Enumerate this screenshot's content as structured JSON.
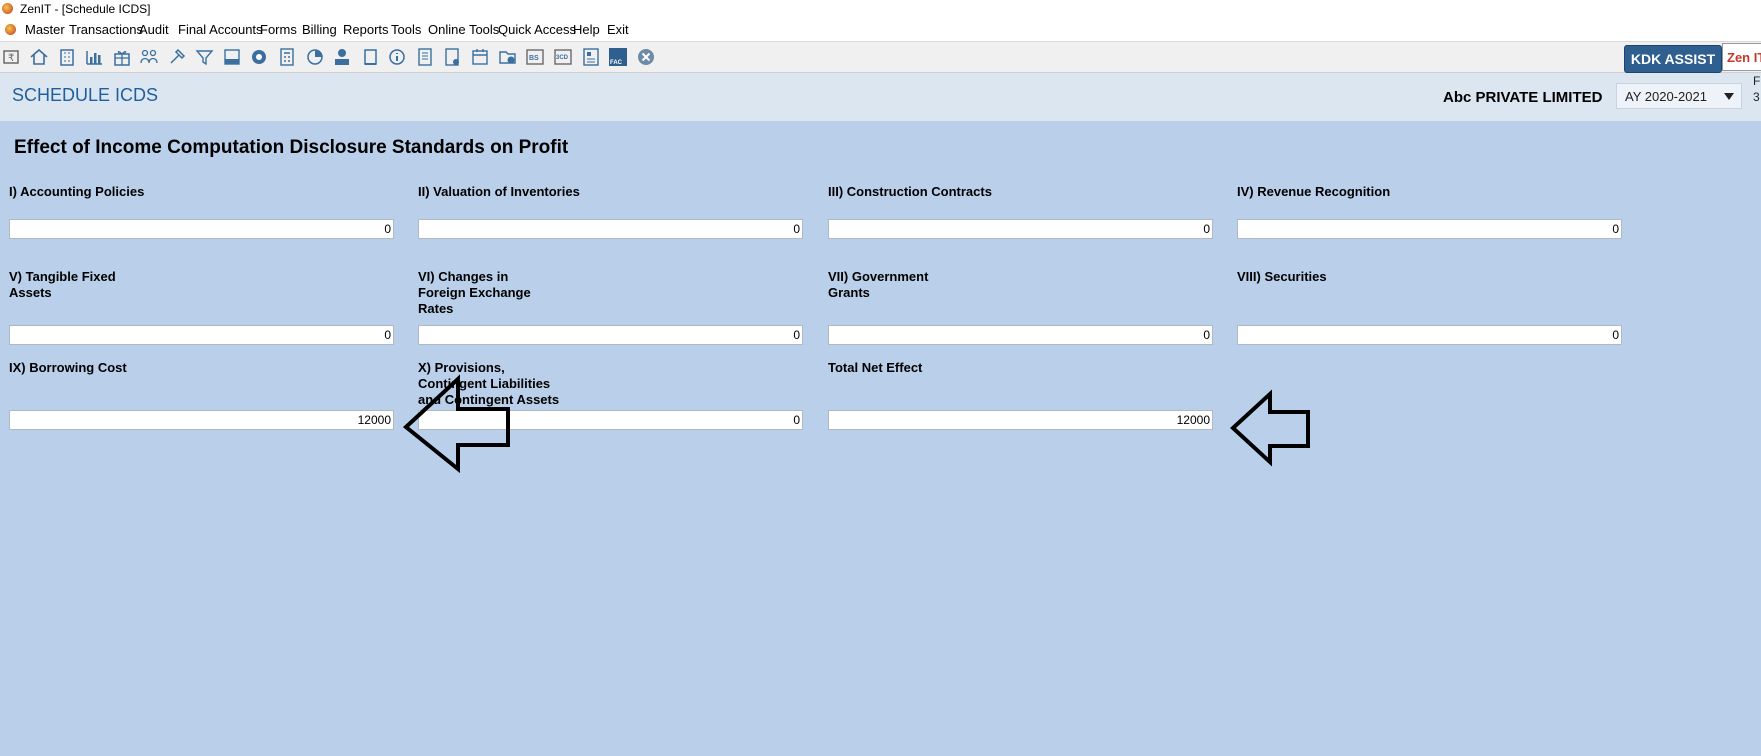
{
  "window": {
    "title": "ZenIT - [Schedule ICDS]"
  },
  "menu": {
    "items": [
      "Master",
      "Transactions",
      "Audit",
      "Final Accounts",
      "Forms",
      "Billing",
      "Reports",
      "Tools",
      "Online Tools",
      "Quick Access",
      "Help",
      "Exit"
    ]
  },
  "toolbar": {
    "icons": [
      "rupee-icon",
      "home-icon",
      "building-icon",
      "bar-chart-icon",
      "gift-icon",
      "users-icon",
      "hammer-icon",
      "filter-icon",
      "tax-icon",
      "eye-icon",
      "calculator-icon",
      "pie-icon",
      "pay-icon",
      "book-icon",
      "info-icon",
      "report-icon",
      "document-icon",
      "calendar-icon",
      "folder-add-icon",
      "bs-icon",
      "3cd-icon",
      "form-icon",
      "fac-icon",
      "close-circle-icon"
    ],
    "kdk_assist": "KDK ASSIST",
    "zen_it": "Zen IT"
  },
  "header": {
    "screen_title": "SCHEDULE ICDS",
    "company": "Abc PRIVATE LIMITED",
    "assessment_year": "AY 2020-2021",
    "edge_text_1": "F",
    "edge_text_2": "3"
  },
  "form": {
    "section_title": "Effect of Income Computation Disclosure Standards on Profit",
    "fields": [
      {
        "label": "I) Accounting Policies",
        "value": "0"
      },
      {
        "label": "II) Valuation of Inventories",
        "value": "0"
      },
      {
        "label": "III) Construction Contracts",
        "value": "0"
      },
      {
        "label": "IV) Revenue Recognition",
        "value": "0"
      },
      {
        "label": "V) Tangible Fixed\nAssets",
        "value": "0"
      },
      {
        "label": "VI) Changes in\nForeign Exchange\nRates",
        "value": "0"
      },
      {
        "label": "VII) Government\nGrants",
        "value": "0"
      },
      {
        "label": "VIII) Securities",
        "value": "0"
      },
      {
        "label": "IX) Borrowing Cost",
        "value": "12000"
      },
      {
        "label": "X) Provisions,\nContingent Liabilities\nand Contingent Assets",
        "value": "0"
      },
      {
        "label": "Total Net Effect",
        "value": "12000"
      }
    ]
  }
}
